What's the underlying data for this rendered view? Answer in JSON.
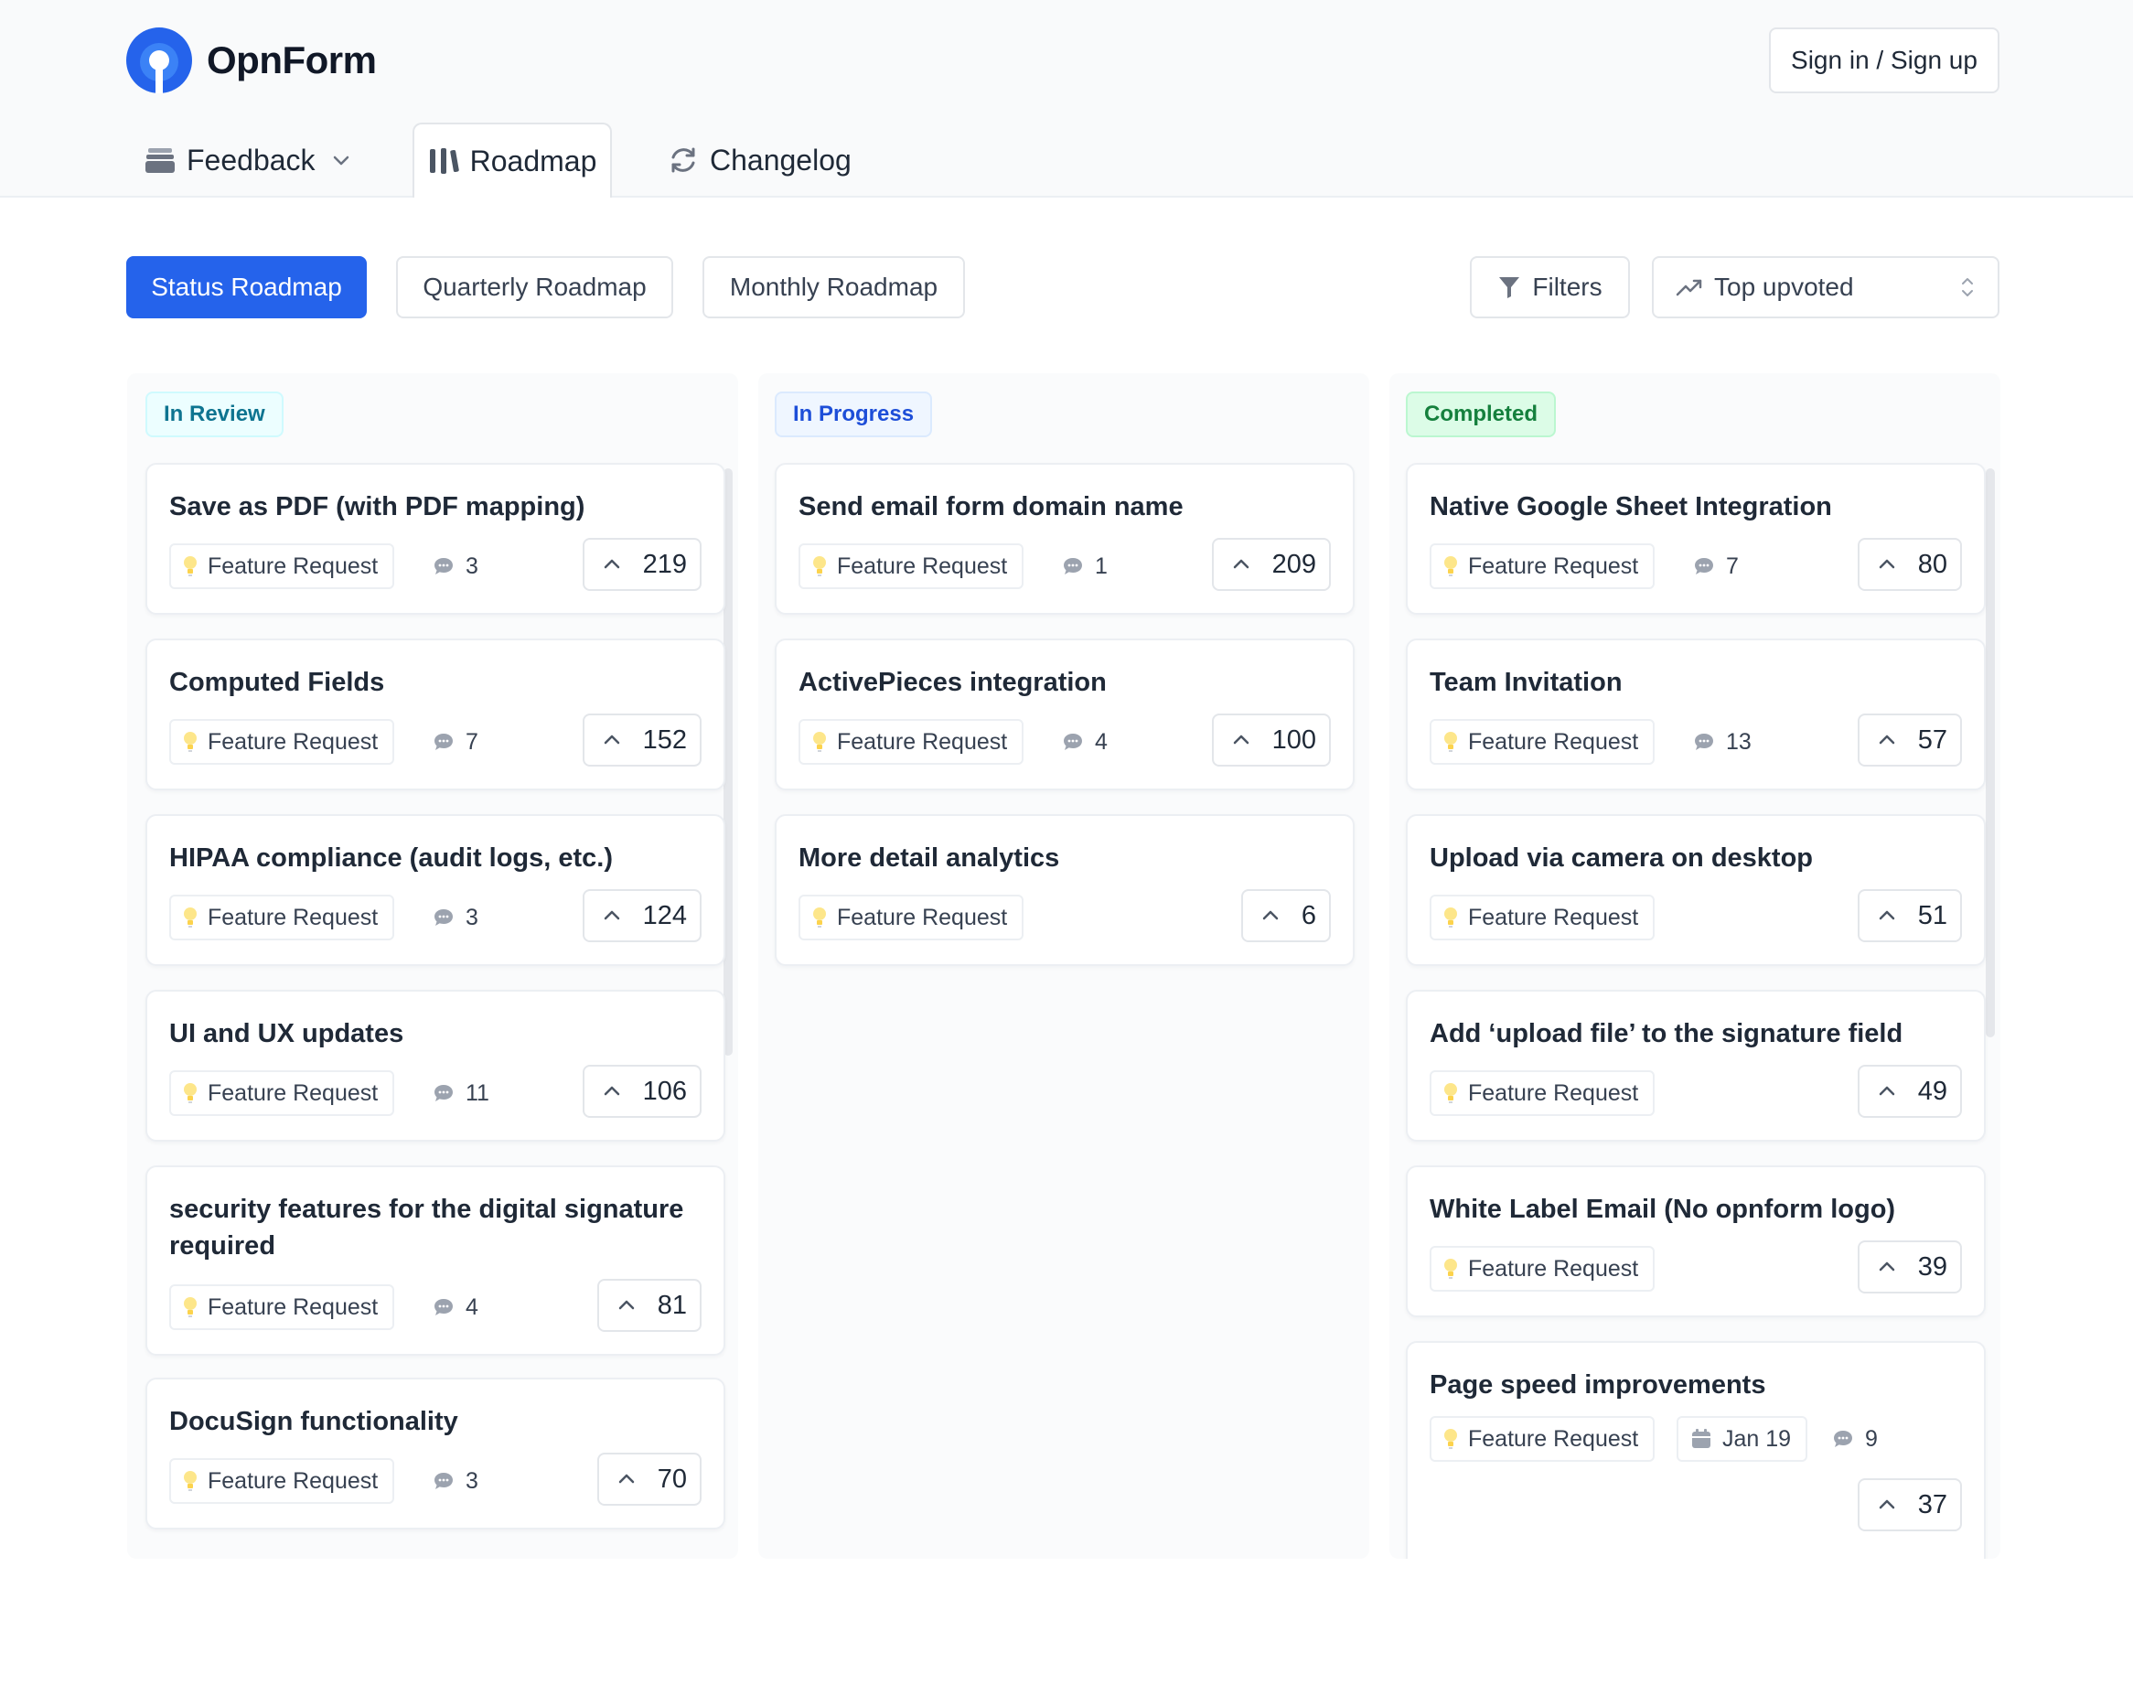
{
  "app": {
    "name": "OpnForm"
  },
  "header": {
    "signin_label": "Sign in / Sign up"
  },
  "nav": {
    "feedback": "Feedback",
    "roadmap": "Roadmap",
    "changelog": "Changelog"
  },
  "subtabs": {
    "status": "Status Roadmap",
    "quarterly": "Quarterly Roadmap",
    "monthly": "Monthly Roadmap"
  },
  "toolbar": {
    "filters": "Filters",
    "sort": "Top upvoted"
  },
  "columns": [
    {
      "label": "In Review",
      "cards": [
        {
          "title": "Save as PDF (with PDF mapping)",
          "tag": "Feature Request",
          "comments": "3",
          "votes": "219"
        },
        {
          "title": "Computed Fields",
          "tag": "Feature Request",
          "comments": "7",
          "votes": "152"
        },
        {
          "title": "HIPAA compliance (audit logs, etc.)",
          "tag": "Feature Request",
          "comments": "3",
          "votes": "124"
        },
        {
          "title": "UI and UX updates",
          "tag": "Feature Request",
          "comments": "11",
          "votes": "106"
        },
        {
          "title": "security features for the digital signature required",
          "tag": "Feature Request",
          "comments": "4",
          "votes": "81"
        },
        {
          "title": "DocuSign functionality",
          "tag": "Feature Request",
          "comments": "3",
          "votes": "70"
        }
      ]
    },
    {
      "label": "In Progress",
      "cards": [
        {
          "title": "Send email form domain name",
          "tag": "Feature Request",
          "comments": "1",
          "votes": "209"
        },
        {
          "title": "ActivePieces integration",
          "tag": "Feature Request",
          "comments": "4",
          "votes": "100"
        },
        {
          "title": "More detail analytics",
          "tag": "Feature Request",
          "votes": "6"
        }
      ]
    },
    {
      "label": "Completed",
      "cards": [
        {
          "title": "Native Google Sheet Integration",
          "tag": "Feature Request",
          "comments": "7",
          "votes": "80"
        },
        {
          "title": "Team Invitation",
          "tag": "Feature Request",
          "comments": "13",
          "votes": "57"
        },
        {
          "title": "Upload via camera on desktop",
          "tag": "Feature Request",
          "votes": "51"
        },
        {
          "title": "Add ‘upload file’ to the signature field",
          "tag": "Feature Request",
          "votes": "49"
        },
        {
          "title": "White Label Email (No opnform logo)",
          "tag": "Feature Request",
          "votes": "39"
        },
        {
          "title": "Page speed improvements",
          "tag": "Feature Request",
          "date": "Jan 19",
          "comments": "9",
          "votes": "37"
        }
      ]
    }
  ],
  "colors": {
    "primary": "#2563eb",
    "in_review_bg": "#ecfeff",
    "in_review_text": "#0e7490",
    "in_progress_bg": "#eff6ff",
    "in_progress_text": "#1d4ed8",
    "completed_bg": "#dcfce7",
    "completed_text": "#15803d"
  },
  "icons": {
    "logo": "opnform-logo",
    "feedback": "inbox-stack-icon",
    "roadmap": "map-icon",
    "changelog": "refresh-icon",
    "filters": "funnel-icon",
    "sort": "trending-up-icon",
    "tag": "lightbulb-icon",
    "comments": "chat-bubble-icon",
    "vote": "chevron-up-icon",
    "date": "calendar-icon"
  }
}
